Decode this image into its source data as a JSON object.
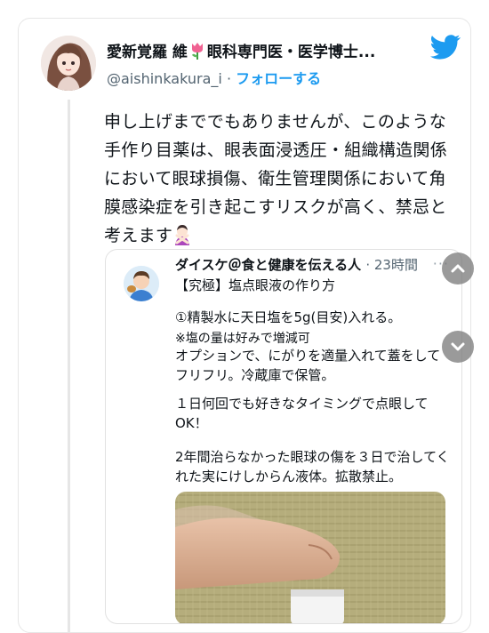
{
  "tweet": {
    "author_name_prefix": "愛新覚羅 維",
    "author_name_suffix": "眼科専門医・医学博士...",
    "handle": "@aishinkakura_i",
    "separator": "·",
    "follow_label": "フォローする",
    "text": "申し上げまででもありませんが、このような手作り目薬は、眼表面浸透圧・組織構造関係において眼球損傷、衛生管理関係において角膜感染症を引き起こすリスクが高く、禁忌と考えます"
  },
  "quoted_tweet": {
    "author_name": "ダイスケ＠食と健康を伝える人",
    "time": "· 23時間",
    "more": "···",
    "title": "【究極】塩点眼液の作り方",
    "line_1": "①精製水に天日塩を5g(目安)入れる。",
    "line_2": "※塩の量は好みで増減可",
    "line_3": "オプションで、にがりを適量入れて蓋をしてフリフリ。冷蔵庫で保管。",
    "line_5": "１日何回でも好きなタイミングで点眼してOK！",
    "line_7": "2年間治らなかった眼球の傷を３日で治してくれた実にけしからん液体。拡散禁止。"
  },
  "colors": {
    "twitter_blue": "#1d9bf0",
    "secondary_text": "#536471"
  },
  "icons": [
    "twitter-bird-icon",
    "tulip-emoji-icon",
    "person-gesturing-no-emoji-icon",
    "chevron-up-icon",
    "chevron-down-icon"
  ]
}
